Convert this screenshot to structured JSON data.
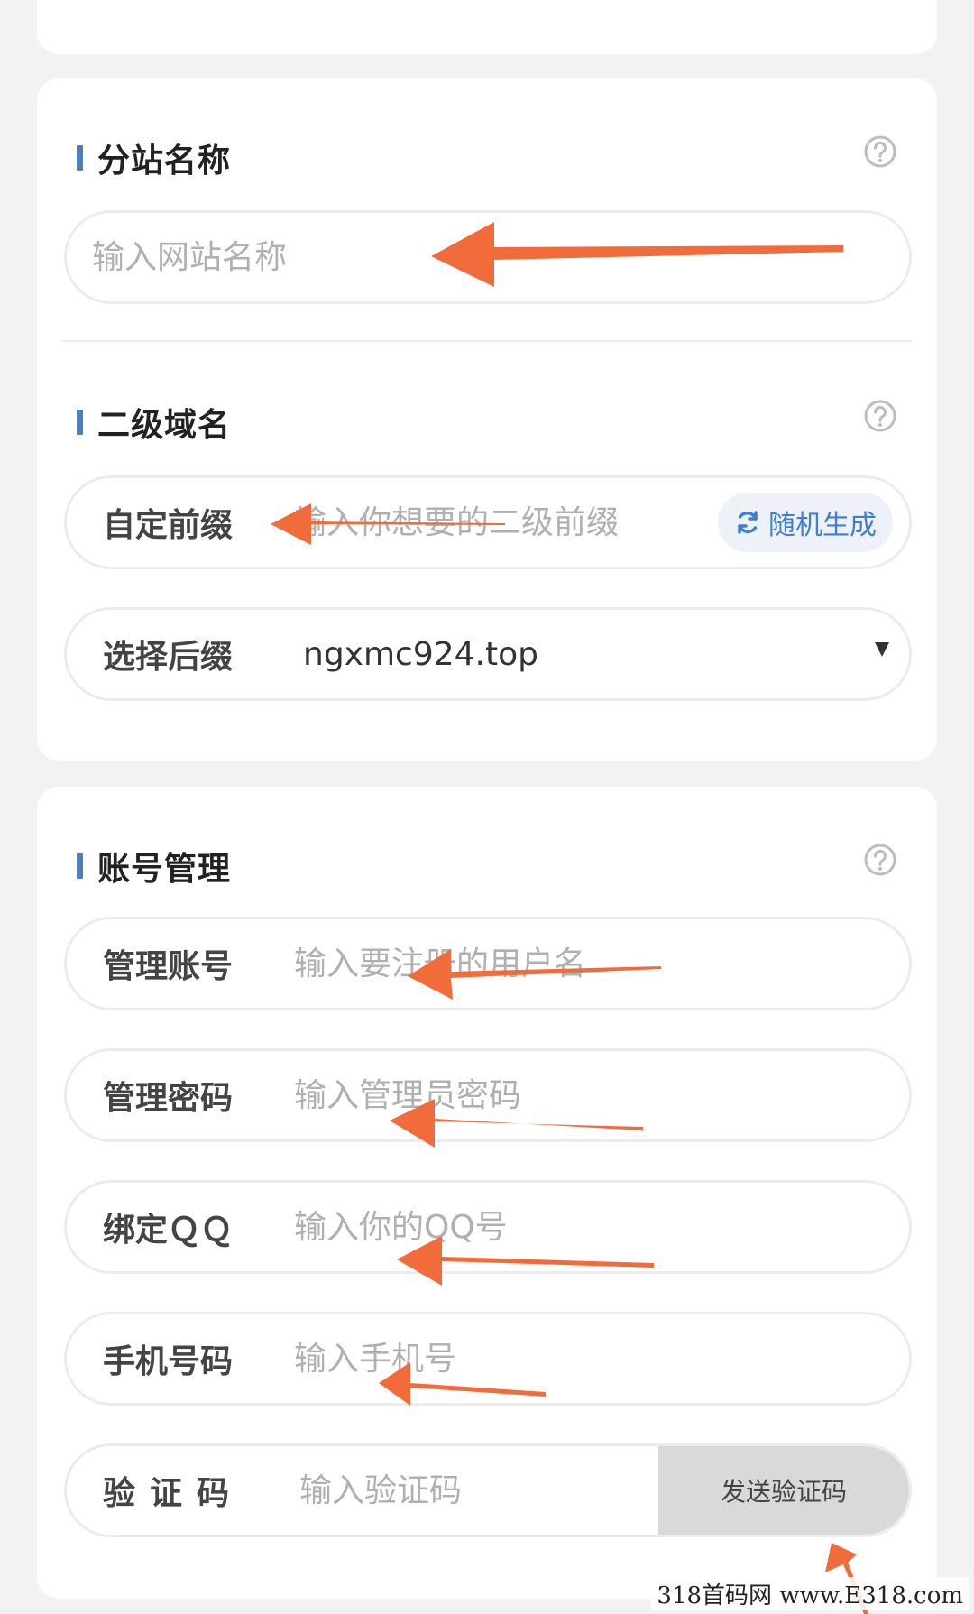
{
  "site_section": {
    "title": "分站名称",
    "input_placeholder": "输入网站名称"
  },
  "domain_section": {
    "title": "二级域名",
    "prefix_label": "自定前缀",
    "prefix_placeholder": "输入你想要的二级前缀",
    "random_button": "随机生成",
    "suffix_label": "选择后缀",
    "suffix_value": "ngxmc924.top"
  },
  "account_section": {
    "title": "账号管理",
    "account_label": "管理账号",
    "account_placeholder": "输入要注册的用户名",
    "password_label": "管理密码",
    "password_placeholder": "输入管理员密码",
    "qq_label": "绑定ＱＱ",
    "qq_placeholder": "输入你的QQ号",
    "phone_label": "手机号码",
    "phone_placeholder": "输入手机号",
    "code_label": "验证码",
    "code_placeholder": "输入验证码",
    "send_code_button": "发送验证码"
  },
  "watermark": "318首码网 www.E318.com",
  "colors": {
    "accent_bar": "#4a7fc1",
    "link_blue": "#3d7fd1",
    "arrow": "#f26b3a"
  },
  "icons": {
    "help": "question-circle-icon",
    "refresh": "refresh-icon",
    "dropdown": "caret-down-icon"
  }
}
